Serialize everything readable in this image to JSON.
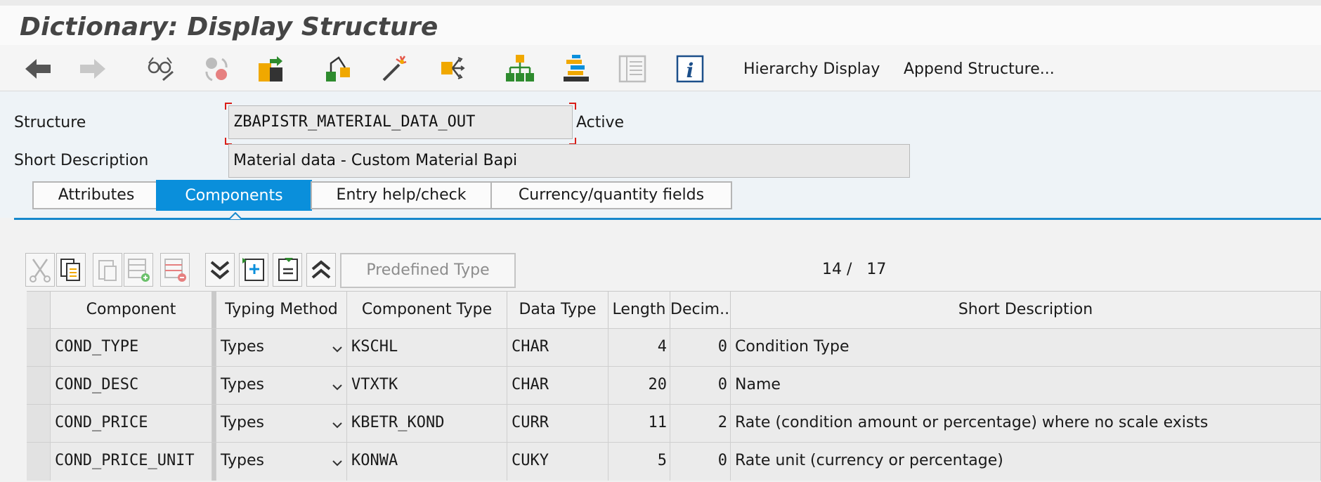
{
  "window": {
    "title": "Dictionary: Display Structure"
  },
  "toolbar": {
    "icons": [
      "back-arrow-icon",
      "forward-arrow-icon",
      "display-change-icon",
      "other-object-icon",
      "activate-icon",
      "check-icon",
      "magic-wand-icon",
      "where-used-icon",
      "hierarchy-icon",
      "object-list-icon",
      "table-view-icon",
      "info-icon"
    ],
    "hierarchy_display": "Hierarchy Display",
    "append_structure": "Append Structure..."
  },
  "header": {
    "structure_label": "Structure",
    "structure_value": "ZBAPISTR_MATERIAL_DATA_OUT",
    "status": "Active",
    "short_desc_label": "Short Description",
    "short_desc_value": "Material data - Custom Material Bapi"
  },
  "tabs": [
    "Attributes",
    "Components",
    "Entry help/check",
    "Currency/quantity fields"
  ],
  "active_tab": "Components",
  "table_toolbar": {
    "icons": [
      "cut-icon",
      "copy-icon",
      "paste-icon",
      "insert-row-icon",
      "delete-row-icon",
      "expand-all-icon",
      "insert-include-icon",
      "collapse-include-icon",
      "collapse-all-icon"
    ],
    "predefined_type": "Predefined Type",
    "counter_current": "14 /",
    "counter_total": "17"
  },
  "columns": [
    "Component",
    "Typing Method",
    "Component Type",
    "Data Type",
    "Length",
    "Decim...",
    "Short Description"
  ],
  "rows": [
    {
      "component": "COND_TYPE",
      "typing": "Types",
      "comptype": "KSCHL",
      "datatype": "CHAR",
      "length": "4",
      "decimals": "0",
      "desc": "Condition Type"
    },
    {
      "component": "COND_DESC",
      "typing": "Types",
      "comptype": "VTXTK",
      "datatype": "CHAR",
      "length": "20",
      "decimals": "0",
      "desc": "Name"
    },
    {
      "component": "COND_PRICE",
      "typing": "Types",
      "comptype": "KBETR_KOND",
      "datatype": "CURR",
      "length": "11",
      "decimals": "2",
      "desc": "Rate (condition amount or percentage) where no scale exists"
    },
    {
      "component": "COND_PRICE_UNIT",
      "typing": "Types",
      "comptype": "KONWA",
      "datatype": "CUKY",
      "length": "5",
      "decimals": "0",
      "desc": "Rate unit (currency or percentage)"
    }
  ],
  "colors": {
    "accent": "#0a8fdb",
    "required_corner": "#d91e18",
    "icon_orange": "#f0a800",
    "icon_green": "#2e8b2e"
  }
}
